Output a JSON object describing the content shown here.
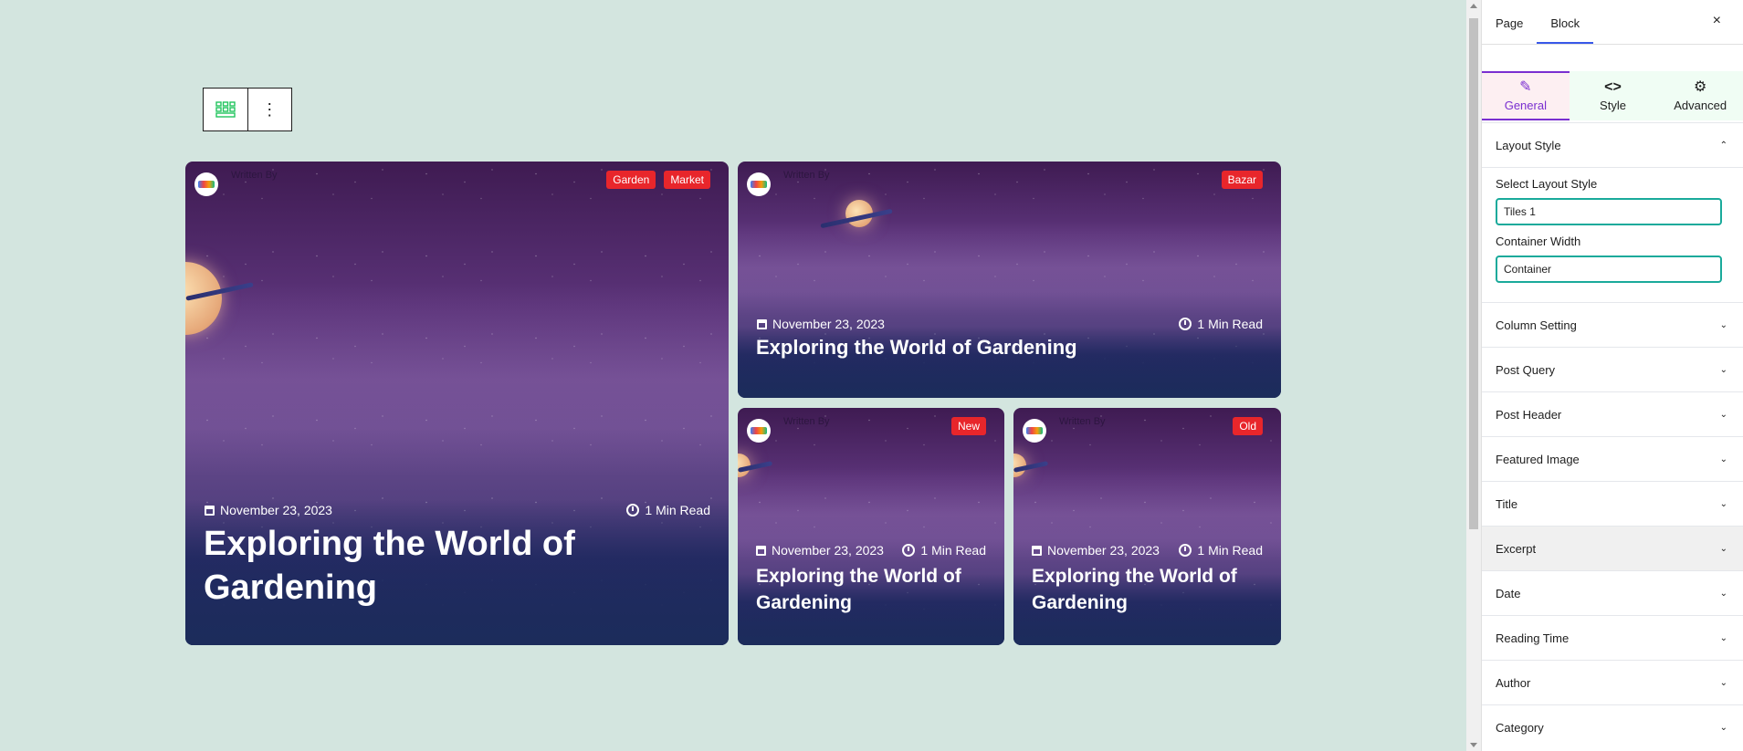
{
  "toolbar": {
    "block_icon": "grid-icon",
    "more_icon": "more-vertical-icon",
    "more_glyph": "⋮"
  },
  "posts": [
    {
      "written_by": "Written By",
      "categories": [
        "Garden",
        "Market"
      ],
      "date": "November 23, 2023",
      "read_time": "1 Min Read",
      "title": "Exploring the World of Gardening"
    },
    {
      "written_by": "Written By",
      "categories": [
        "Bazar"
      ],
      "date": "November 23, 2023",
      "read_time": "1 Min Read",
      "title": "Exploring the World of Gardening"
    },
    {
      "written_by": "Written By",
      "categories": [
        "New"
      ],
      "date": "November 23, 2023",
      "read_time": "1 Min Read",
      "title": "Exploring the World of Gardening"
    },
    {
      "written_by": "Written By",
      "categories": [
        "Old"
      ],
      "date": "November 23, 2023",
      "read_time": "1 Min Read",
      "title": "Exploring the World of Gardening"
    }
  ],
  "sidebar": {
    "tabs": [
      "Page",
      "Block"
    ],
    "active_tab": "Block",
    "close_glyph": "×",
    "subtabs": [
      {
        "label": "General",
        "icon": "pencil-icon",
        "glyph": "✎"
      },
      {
        "label": "Style",
        "icon": "code-icon",
        "glyph": "<>"
      },
      {
        "label": "Advanced",
        "icon": "gear-icon",
        "glyph": "⚙"
      }
    ],
    "layout_style": {
      "heading": "Layout Style",
      "select_label": "Select Layout Style",
      "select_value": "Tiles 1",
      "width_label": "Container Width",
      "width_value": "Container"
    },
    "sections": [
      "Column Setting",
      "Post Query",
      "Post Header",
      "Featured Image",
      "Title",
      "Excerpt",
      "Date",
      "Reading Time",
      "Author",
      "Category"
    ],
    "colors": {
      "accent": "#7a2fd0",
      "field_border": "#1aaa9b",
      "badge": "#e8262b"
    }
  }
}
